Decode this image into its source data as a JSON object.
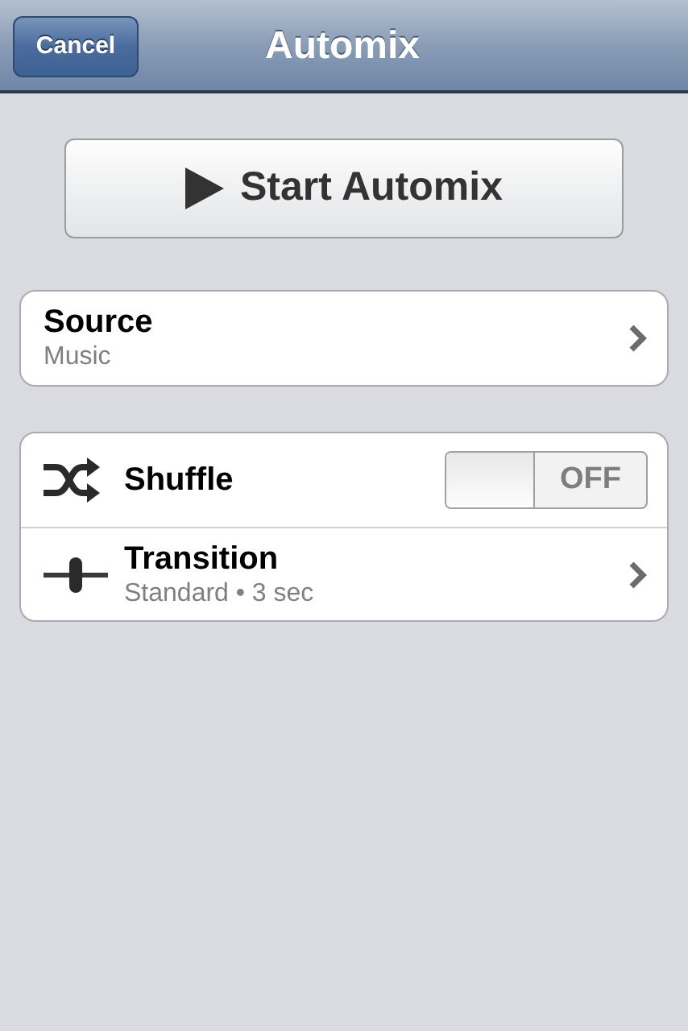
{
  "nav": {
    "cancel": "Cancel",
    "title": "Automix"
  },
  "start_button": {
    "label": "Start Automix"
  },
  "groups": [
    {
      "rows": [
        {
          "kind": "link",
          "title": "Source",
          "subtitle": "Music"
        }
      ]
    },
    {
      "rows": [
        {
          "kind": "shuffle-switch",
          "title": "Shuffle",
          "on": false,
          "switch_label": "OFF"
        },
        {
          "kind": "fader-link",
          "title": "Transition",
          "subtitle": "Standard • 3 sec"
        }
      ]
    }
  ]
}
